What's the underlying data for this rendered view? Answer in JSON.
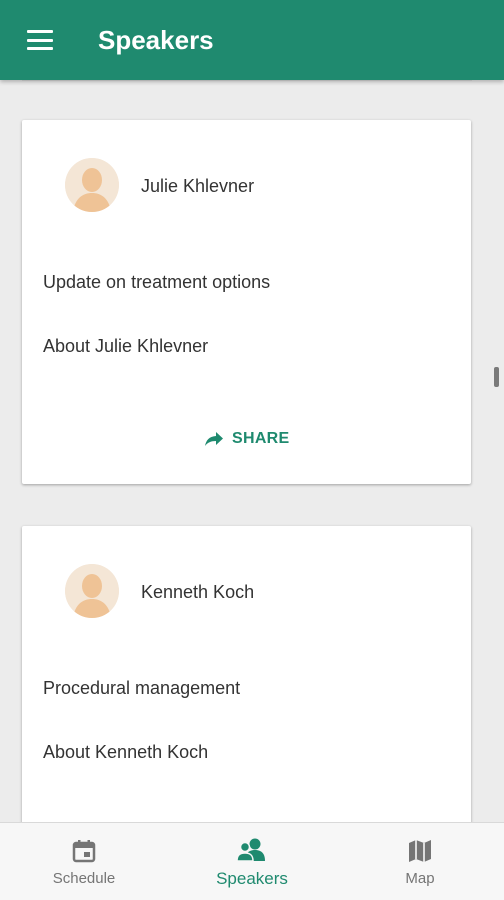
{
  "app": {
    "title": "Speakers"
  },
  "speakers": [
    {
      "name": "Julie Khlevner",
      "talk": "Update on treatment options",
      "about": "About Julie Khlevner",
      "share": "SHARE"
    },
    {
      "name": "Kenneth Koch",
      "talk": "Procedural management",
      "about": "About Kenneth Koch"
    }
  ],
  "bottom_nav": [
    {
      "label": "Schedule",
      "icon": "calendar-icon",
      "active": false
    },
    {
      "label": "Speakers",
      "icon": "speakers-icon",
      "active": true
    },
    {
      "label": "Map",
      "icon": "map-icon",
      "active": false
    }
  ],
  "colors": {
    "primary": "#1f8a6f",
    "background": "#ececec"
  }
}
